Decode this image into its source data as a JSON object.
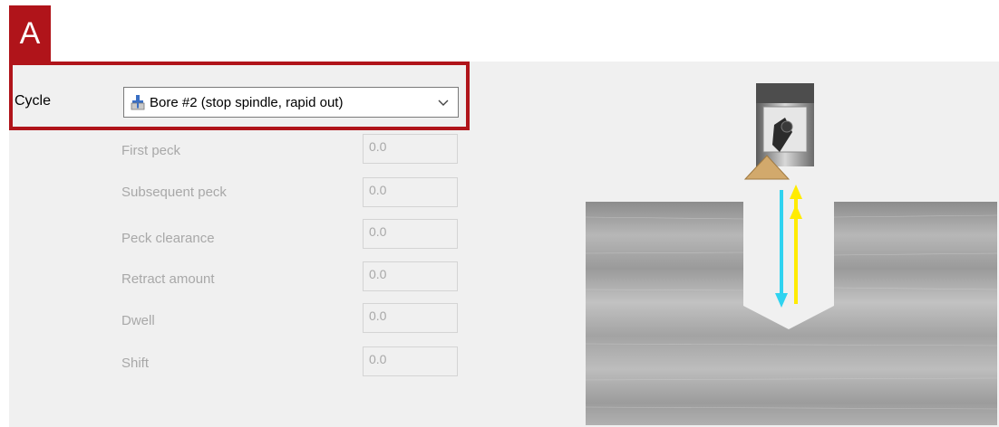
{
  "badge": {
    "label": "A"
  },
  "cycle": {
    "label": "Cycle",
    "selected_value": "Bore #2 (stop spindle, rapid out)",
    "icon": "bore-tool-icon"
  },
  "params": [
    {
      "label": "First peck",
      "value": "0.0"
    },
    {
      "label": "Subsequent peck",
      "value": "0.0"
    },
    {
      "label": "Peck clearance",
      "value": "0.0"
    },
    {
      "label": "Retract amount",
      "value": "0.0"
    },
    {
      "label": "Dwell",
      "value": "0.0"
    },
    {
      "label": "Shift",
      "value": "0.0"
    }
  ],
  "colors": {
    "highlight": "#b0141a",
    "feed_in_arrow": "#2fd3f0",
    "rapid_out_arrow": "#ffeb00"
  }
}
